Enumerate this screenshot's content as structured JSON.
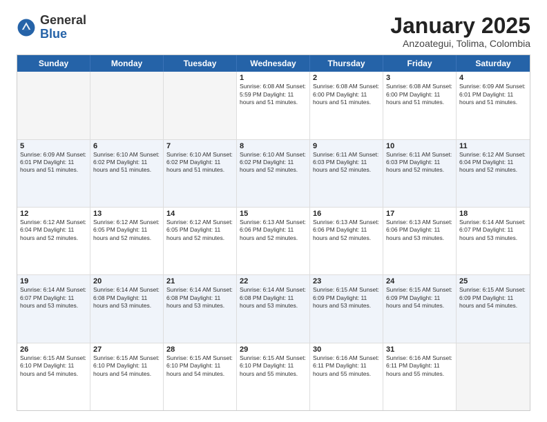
{
  "logo": {
    "general": "General",
    "blue": "Blue"
  },
  "header": {
    "title": "January 2025",
    "subtitle": "Anzoategui, Tolima, Colombia"
  },
  "days_of_week": [
    "Sunday",
    "Monday",
    "Tuesday",
    "Wednesday",
    "Thursday",
    "Friday",
    "Saturday"
  ],
  "weeks": [
    [
      {
        "day": "",
        "info": ""
      },
      {
        "day": "",
        "info": ""
      },
      {
        "day": "",
        "info": ""
      },
      {
        "day": "1",
        "info": "Sunrise: 6:08 AM\nSunset: 5:59 PM\nDaylight: 11 hours and 51 minutes."
      },
      {
        "day": "2",
        "info": "Sunrise: 6:08 AM\nSunset: 6:00 PM\nDaylight: 11 hours and 51 minutes."
      },
      {
        "day": "3",
        "info": "Sunrise: 6:08 AM\nSunset: 6:00 PM\nDaylight: 11 hours and 51 minutes."
      },
      {
        "day": "4",
        "info": "Sunrise: 6:09 AM\nSunset: 6:01 PM\nDaylight: 11 hours and 51 minutes."
      }
    ],
    [
      {
        "day": "5",
        "info": "Sunrise: 6:09 AM\nSunset: 6:01 PM\nDaylight: 11 hours and 51 minutes."
      },
      {
        "day": "6",
        "info": "Sunrise: 6:10 AM\nSunset: 6:02 PM\nDaylight: 11 hours and 51 minutes."
      },
      {
        "day": "7",
        "info": "Sunrise: 6:10 AM\nSunset: 6:02 PM\nDaylight: 11 hours and 51 minutes."
      },
      {
        "day": "8",
        "info": "Sunrise: 6:10 AM\nSunset: 6:02 PM\nDaylight: 11 hours and 52 minutes."
      },
      {
        "day": "9",
        "info": "Sunrise: 6:11 AM\nSunset: 6:03 PM\nDaylight: 11 hours and 52 minutes."
      },
      {
        "day": "10",
        "info": "Sunrise: 6:11 AM\nSunset: 6:03 PM\nDaylight: 11 hours and 52 minutes."
      },
      {
        "day": "11",
        "info": "Sunrise: 6:12 AM\nSunset: 6:04 PM\nDaylight: 11 hours and 52 minutes."
      }
    ],
    [
      {
        "day": "12",
        "info": "Sunrise: 6:12 AM\nSunset: 6:04 PM\nDaylight: 11 hours and 52 minutes."
      },
      {
        "day": "13",
        "info": "Sunrise: 6:12 AM\nSunset: 6:05 PM\nDaylight: 11 hours and 52 minutes."
      },
      {
        "day": "14",
        "info": "Sunrise: 6:12 AM\nSunset: 6:05 PM\nDaylight: 11 hours and 52 minutes."
      },
      {
        "day": "15",
        "info": "Sunrise: 6:13 AM\nSunset: 6:06 PM\nDaylight: 11 hours and 52 minutes."
      },
      {
        "day": "16",
        "info": "Sunrise: 6:13 AM\nSunset: 6:06 PM\nDaylight: 11 hours and 52 minutes."
      },
      {
        "day": "17",
        "info": "Sunrise: 6:13 AM\nSunset: 6:06 PM\nDaylight: 11 hours and 53 minutes."
      },
      {
        "day": "18",
        "info": "Sunrise: 6:14 AM\nSunset: 6:07 PM\nDaylight: 11 hours and 53 minutes."
      }
    ],
    [
      {
        "day": "19",
        "info": "Sunrise: 6:14 AM\nSunset: 6:07 PM\nDaylight: 11 hours and 53 minutes."
      },
      {
        "day": "20",
        "info": "Sunrise: 6:14 AM\nSunset: 6:08 PM\nDaylight: 11 hours and 53 minutes."
      },
      {
        "day": "21",
        "info": "Sunrise: 6:14 AM\nSunset: 6:08 PM\nDaylight: 11 hours and 53 minutes."
      },
      {
        "day": "22",
        "info": "Sunrise: 6:14 AM\nSunset: 6:08 PM\nDaylight: 11 hours and 53 minutes."
      },
      {
        "day": "23",
        "info": "Sunrise: 6:15 AM\nSunset: 6:09 PM\nDaylight: 11 hours and 53 minutes."
      },
      {
        "day": "24",
        "info": "Sunrise: 6:15 AM\nSunset: 6:09 PM\nDaylight: 11 hours and 54 minutes."
      },
      {
        "day": "25",
        "info": "Sunrise: 6:15 AM\nSunset: 6:09 PM\nDaylight: 11 hours and 54 minutes."
      }
    ],
    [
      {
        "day": "26",
        "info": "Sunrise: 6:15 AM\nSunset: 6:10 PM\nDaylight: 11 hours and 54 minutes."
      },
      {
        "day": "27",
        "info": "Sunrise: 6:15 AM\nSunset: 6:10 PM\nDaylight: 11 hours and 54 minutes."
      },
      {
        "day": "28",
        "info": "Sunrise: 6:15 AM\nSunset: 6:10 PM\nDaylight: 11 hours and 54 minutes."
      },
      {
        "day": "29",
        "info": "Sunrise: 6:15 AM\nSunset: 6:10 PM\nDaylight: 11 hours and 55 minutes."
      },
      {
        "day": "30",
        "info": "Sunrise: 6:16 AM\nSunset: 6:11 PM\nDaylight: 11 hours and 55 minutes."
      },
      {
        "day": "31",
        "info": "Sunrise: 6:16 AM\nSunset: 6:11 PM\nDaylight: 11 hours and 55 minutes."
      },
      {
        "day": "",
        "info": ""
      }
    ]
  ]
}
